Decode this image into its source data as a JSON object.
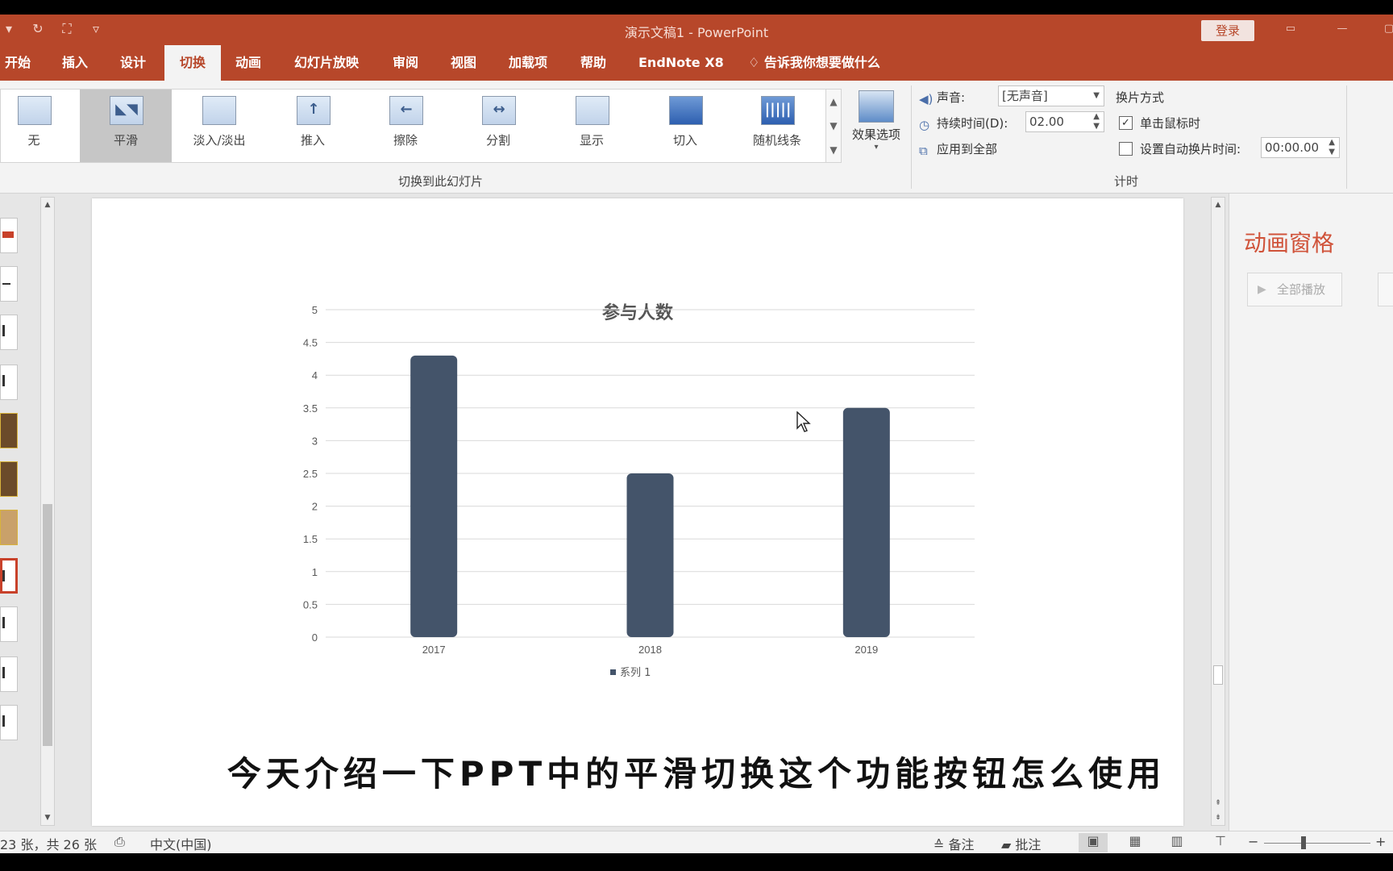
{
  "titlebar": {
    "title": "演示文稿1  -  PowerPoint",
    "login": "登录",
    "qat_icons": [
      "undo-dropdown-icon",
      "redo-icon",
      "start-from-beginning-icon",
      "customize-qat-icon"
    ]
  },
  "tabs": [
    "开始",
    "插入",
    "设计",
    "切换",
    "动画",
    "幻灯片放映",
    "审阅",
    "视图",
    "加载项",
    "帮助",
    "EndNote X8"
  ],
  "active_tab": "切换",
  "tell_me": "告诉我你想要做什么",
  "ribbon": {
    "transitions": [
      {
        "label": "无",
        "icon": "none-transition-icon"
      },
      {
        "label": "平滑",
        "icon": "morph-transition-icon",
        "selected": true
      },
      {
        "label": "淡入/淡出",
        "icon": "fade-transition-icon"
      },
      {
        "label": "推入",
        "icon": "push-transition-icon"
      },
      {
        "label": "擦除",
        "icon": "wipe-transition-icon"
      },
      {
        "label": "分割",
        "icon": "split-transition-icon"
      },
      {
        "label": "显示",
        "icon": "reveal-transition-icon"
      },
      {
        "label": "切入",
        "icon": "cut-transition-icon"
      },
      {
        "label": "随机线条",
        "icon": "random-bars-transition-icon"
      }
    ],
    "effect_options": "效果选项",
    "group_transition_label": "切换到此幻灯片",
    "sound_label": "声音:",
    "sound_value": "[无声音]",
    "duration_label": "持续时间(D):",
    "duration_value": "02.00",
    "apply_all": "应用到全部",
    "advance_header": "换片方式",
    "on_click_label": "单击鼠标时",
    "on_click_checked": true,
    "after_label": "设置自动换片时间:",
    "after_checked": false,
    "after_value": "00:00.00",
    "group_timing_label": "计时"
  },
  "chart_data": {
    "type": "bar",
    "title": "参与人数",
    "categories": [
      "2017",
      "2018",
      "2019"
    ],
    "series": [
      {
        "name": "系列 1",
        "values": [
          4.3,
          2.5,
          3.5
        ],
        "color": "#44546a"
      }
    ],
    "ylim": [
      0,
      5
    ],
    "yticks": [
      "0",
      "0.5",
      "1",
      "1.5",
      "2",
      "2.5",
      "3",
      "3.5",
      "4",
      "4.5",
      "5"
    ],
    "grid": true,
    "legend_position": "bottom"
  },
  "subtitle": "今天介绍一下PPT中的平滑切换这个功能按钮怎么使用",
  "animation_pane": {
    "title": "动画窗格",
    "play_all": "全部播放"
  },
  "status": {
    "slide_info": "23 张，共 26 张",
    "language": "中文(中国)",
    "notes": "备注",
    "comments": "批注"
  },
  "colors": {
    "brand": "#b7472a",
    "bar": "#44546a",
    "pane_title": "#d0533a"
  }
}
